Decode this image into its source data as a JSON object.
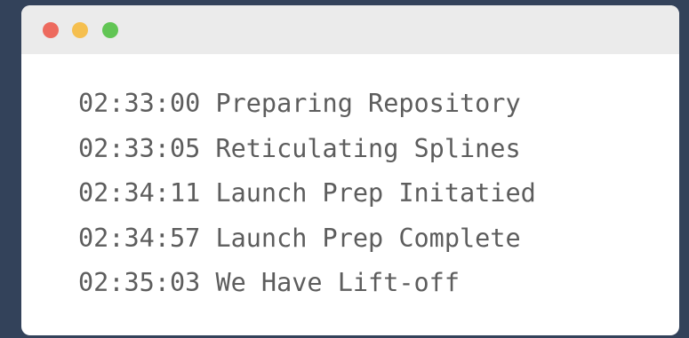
{
  "window": {
    "traffic_lights": [
      {
        "name": "close",
        "color": "#ed6a5e"
      },
      {
        "name": "minimize",
        "color": "#f5bf4f"
      },
      {
        "name": "zoom",
        "color": "#61c554"
      }
    ]
  },
  "console": {
    "lines": [
      {
        "time": "02:33:00",
        "message": "Preparing Repository"
      },
      {
        "time": "02:33:05",
        "message": "Reticulating Splines"
      },
      {
        "time": "02:34:11",
        "message": "Launch Prep Initatied"
      },
      {
        "time": "02:34:57",
        "message": "Launch Prep Complete"
      },
      {
        "time": "02:35:03",
        "message": "We Have Lift-off"
      }
    ]
  }
}
